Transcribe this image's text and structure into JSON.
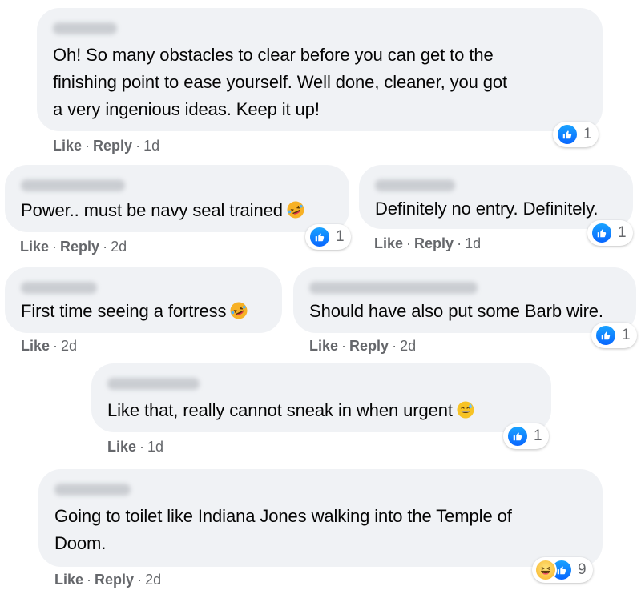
{
  "comments": [
    {
      "text_lines": [
        "Oh! So many obstacles to clear before you can get to the",
        "finishing point to ease yourself. Well done, cleaner, you got",
        "a very ingenious ideas. Keep it up!"
      ],
      "like": "Like",
      "reply": "Reply",
      "time": "1d",
      "reaction_count": "1"
    },
    {
      "text": "Power.. must be navy seal trained",
      "emoji": "rofl-emoji",
      "like": "Like",
      "reply": "Reply",
      "time": "2d",
      "reaction_count": "1"
    },
    {
      "text": "Definitely no entry. Definitely.",
      "like": "Like",
      "reply": "Reply",
      "time": "1d",
      "reaction_count": "1"
    },
    {
      "text": "First time seeing a fortress",
      "emoji": "rofl-emoji",
      "like": "Like",
      "time": "2d"
    },
    {
      "text": "Should have also put some Barb wire.",
      "like": "Like",
      "reply": "Reply",
      "time": "2d",
      "reaction_count": "1"
    },
    {
      "text": "Like that, really cannot sneak in when urgent",
      "emoji": "sweat-smile-emoji",
      "like": "Like",
      "time": "1d",
      "reaction_count": "1"
    },
    {
      "text_lines": [
        "Going to toilet like Indiana Jones walking into the Temple of",
        "Doom."
      ],
      "like": "Like",
      "reply": "Reply",
      "time": "2d",
      "reaction_count": "9",
      "reactions": [
        "haha-icon",
        "like-icon"
      ]
    }
  ],
  "colors": {
    "bubble": "#f0f2f5",
    "meta_text": "#65676b",
    "like_blue": "#0866ff",
    "text": "#050505"
  }
}
